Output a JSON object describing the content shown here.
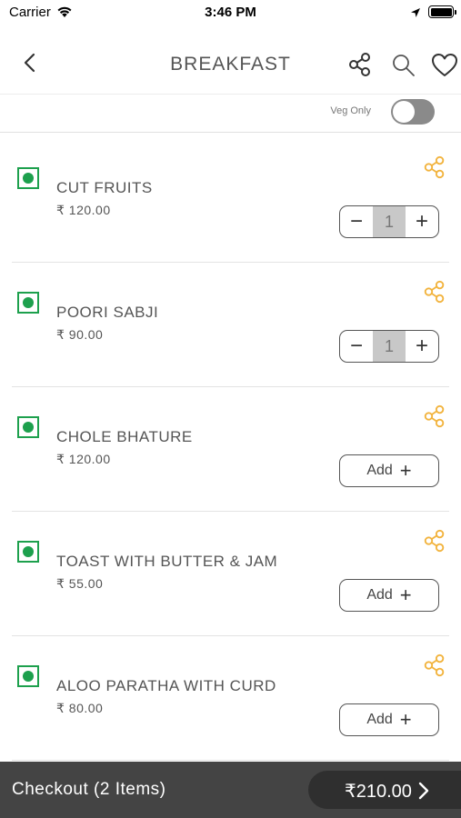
{
  "status_bar": {
    "carrier": "Carrier",
    "time": "3:46 PM"
  },
  "header": {
    "title": "BREAKFAST",
    "icons": [
      "back-icon",
      "share-icon",
      "search-icon",
      "heart-icon"
    ]
  },
  "filter": {
    "veg_only_label": "Veg Only",
    "veg_only_enabled": false
  },
  "items": [
    {
      "name": "CUT FRUITS",
      "price": "₹ 120.00",
      "veg": true,
      "in_cart": true,
      "quantity": "1"
    },
    {
      "name": "POORI SABJI",
      "price": "₹ 90.00",
      "veg": true,
      "in_cart": true,
      "quantity": "1"
    },
    {
      "name": "CHOLE BHATURE",
      "price": "₹ 120.00",
      "veg": true,
      "in_cart": false,
      "add_label": "Add"
    },
    {
      "name": "TOAST WITH BUTTER & JAM",
      "price": "₹ 55.00",
      "veg": true,
      "in_cart": false,
      "add_label": "Add"
    },
    {
      "name": "ALOO PARATHA WITH CURD",
      "price": "₹ 80.00",
      "veg": true,
      "in_cart": false,
      "add_label": "Add"
    }
  ],
  "stepper": {
    "minus": "−",
    "plus": "+"
  },
  "add_plus": "+",
  "checkout": {
    "label": "Checkout (2 Items)",
    "total": "₹210.00"
  },
  "colors": {
    "veg_green": "#1da04d",
    "share_accent": "#f2b33d",
    "checkout_bg": "#444444"
  }
}
